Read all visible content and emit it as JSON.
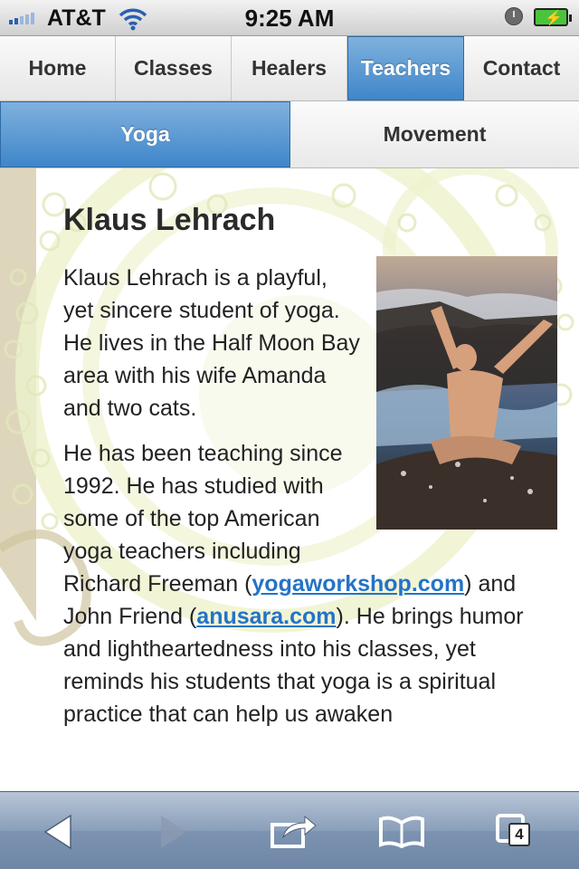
{
  "status_bar": {
    "carrier": "AT&T",
    "time": "9:25 AM"
  },
  "nav": {
    "items": [
      {
        "label": "Home"
      },
      {
        "label": "Classes"
      },
      {
        "label": "Healers"
      },
      {
        "label": "Teachers"
      },
      {
        "label": "Contact"
      }
    ]
  },
  "subnav": {
    "items": [
      {
        "label": "Yoga"
      },
      {
        "label": "Movement"
      }
    ]
  },
  "article": {
    "title": "Klaus Lehrach",
    "para1": "Klaus Lehrach is a playful, yet sincere student of yoga. He lives in the Half Moon Bay area with his wife Amanda and two cats.",
    "para2_a": "He has been teaching since 1992. He has studied with some of the top American yoga teachers including Richard Freeman (",
    "link1": "yogaworkshop.com",
    "para2_b": ") and John Friend (",
    "link2": "anusara.com",
    "para2_c": "). He brings humor and lightheartedness into his classes, yet reminds his students that yoga is a spiritual practice that can help us awaken"
  },
  "toolbar": {
    "tabs_count": "4"
  }
}
